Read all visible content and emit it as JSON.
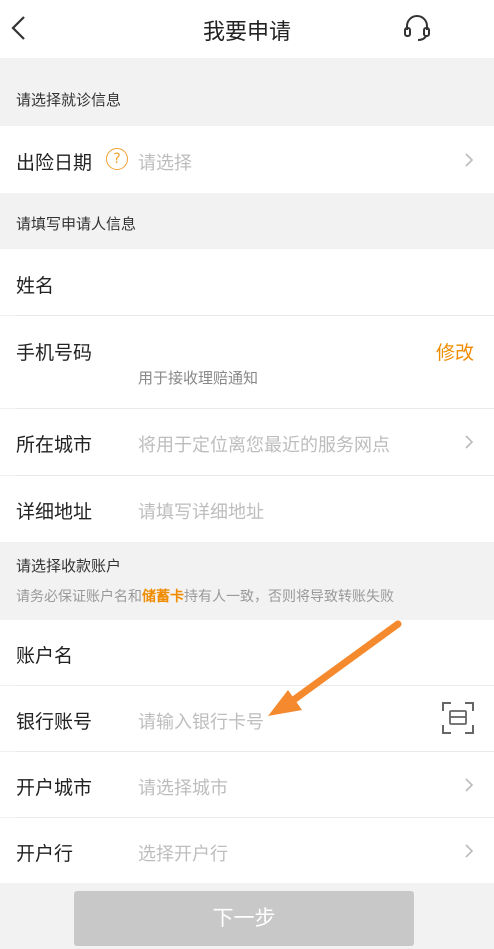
{
  "header": {
    "title": "我要申请"
  },
  "visit_section": {
    "title": "请选择就诊信息"
  },
  "visit_date": {
    "label": "出险日期",
    "help": "?",
    "placeholder": "请选择"
  },
  "applicant_section": {
    "title": "请填写申请人信息"
  },
  "name": {
    "label": "姓名"
  },
  "phone": {
    "label": "手机号码",
    "action": "修改",
    "hint": "用于接收理赔通知"
  },
  "city": {
    "label": "所在城市",
    "placeholder": "将用于定位离您最近的服务网点"
  },
  "address": {
    "label": "详细地址",
    "placeholder": "请填写详细地址"
  },
  "account_section": {
    "title": "请选择收款账户",
    "note_pre": "请务必保证账户名和",
    "note_highlight": "储蓄卡",
    "note_post": "持有人一致，否则将导致转账失败"
  },
  "account_name": {
    "label": "账户名"
  },
  "bank_account": {
    "label": "银行账号",
    "placeholder": "请输入银行卡号"
  },
  "bank_city": {
    "label": "开户城市",
    "placeholder": "请选择城市"
  },
  "bank_branch": {
    "label": "开户行",
    "placeholder": "选择开户行"
  },
  "footer": {
    "next_label": "下一步"
  },
  "colors": {
    "accent": "#f08c00",
    "arrow": "#f5892e",
    "button_disabled": "#c8c8c8"
  }
}
